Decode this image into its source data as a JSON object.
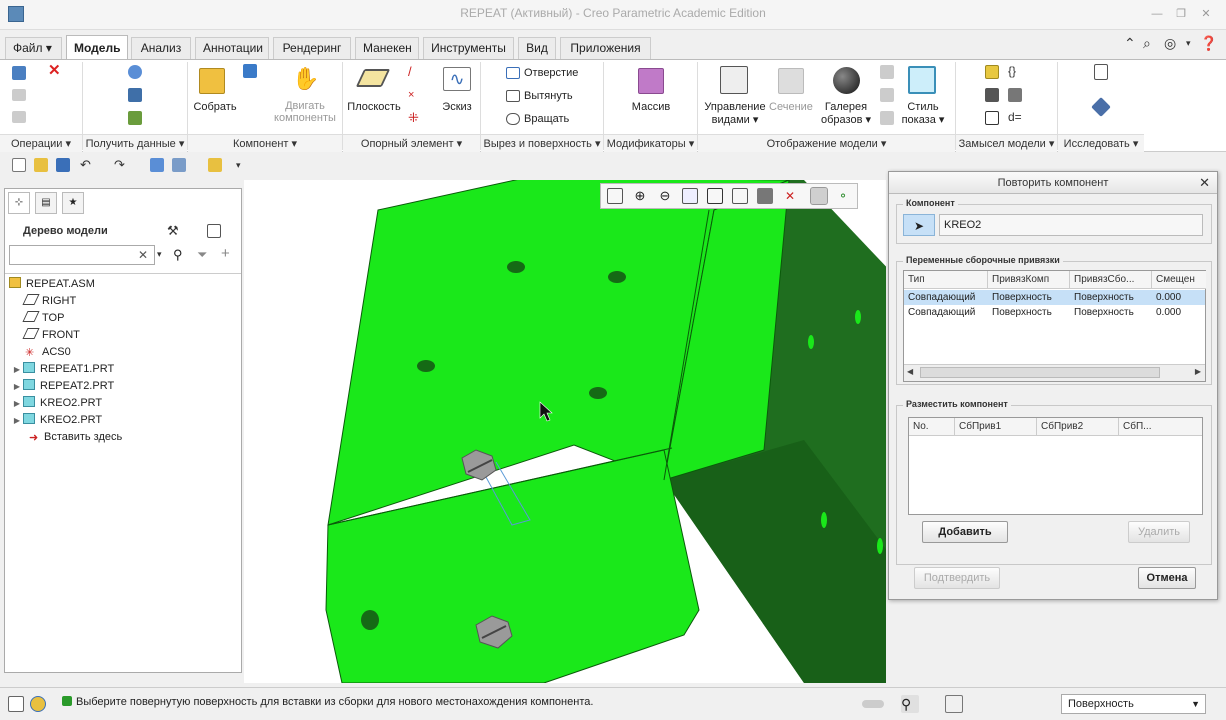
{
  "window": {
    "title": "REPEAT (Активный) - Creo Parametric Academic Edition"
  },
  "menu": {
    "file": "Файл",
    "tabs": [
      "Модель",
      "Анализ",
      "Аннотации",
      "Рендеринг",
      "Манекен",
      "Инструменты",
      "Вид",
      "Приложения"
    ]
  },
  "ribbon": {
    "assemble": "Собрать",
    "drag_components": [
      "Двигать",
      "компоненты"
    ],
    "plane": "Плоскость",
    "sketch": "Эскиз",
    "hole": "Отверстие",
    "extrude": "Вытянуть",
    "revolve": "Вращать",
    "pattern": "Массив",
    "manage_views": [
      "Управление",
      "видами"
    ],
    "section": "Сечение",
    "appearance_gallery": [
      "Галерея",
      "образов"
    ],
    "display_style": [
      "Стиль",
      "показа"
    ],
    "groups": [
      "Операции",
      "Получить данные",
      "Компонент",
      "Опорный элемент",
      "Вырез и поверхность",
      "Модификаторы",
      "Отображение модели",
      "Замысел модели",
      "Исследовать"
    ]
  },
  "model_tree": {
    "title": "Дерево модели",
    "search_placeholder": "",
    "items": [
      {
        "label": "REPEAT.ASM",
        "icon": "assembly-icon"
      },
      {
        "label": "RIGHT",
        "icon": "datum-plane-icon"
      },
      {
        "label": "TOP",
        "icon": "datum-plane-icon"
      },
      {
        "label": "FRONT",
        "icon": "datum-plane-icon"
      },
      {
        "label": "ACS0",
        "icon": "csys-icon"
      },
      {
        "label": "REPEAT1.PRT",
        "icon": "part-icon"
      },
      {
        "label": "REPEAT2.PRT",
        "icon": "part-icon"
      },
      {
        "label": "KREO2.PRT",
        "icon": "part-icon"
      },
      {
        "label": "KREO2.PRT",
        "icon": "part-icon"
      },
      {
        "label": "Вставить здесь",
        "icon": "insert-arrow-icon"
      }
    ]
  },
  "dialog": {
    "title": "Повторить компонент",
    "component_legend": "Компонент",
    "component_value": "KREO2",
    "refs_legend": "Переменные сборочные привязки",
    "refs_columns": [
      "Тип",
      "ПривязКомп",
      "ПривязСбо...",
      "Смещен"
    ],
    "refs_rows": [
      [
        "Совпадающий",
        "Поверхность",
        "Поверхность",
        "0.000"
      ],
      [
        "Совпадающий",
        "Поверхность",
        "Поверхность",
        "0.000"
      ]
    ],
    "place_legend": "Разместить компонент",
    "place_columns": [
      "No.",
      "СбПрив1",
      "СбПрив2",
      "СбП..."
    ],
    "add": "Добавить",
    "remove": "Удалить",
    "confirm": "Подтвердить",
    "cancel": "Отмена"
  },
  "status": {
    "message": "Выберите повернутую поверхность для вставки из сборки для нового местонахождения компонента.",
    "filter": "Поверхность"
  },
  "colors": {
    "model_green": "#1aef1a",
    "model_dark_green": "#1f6e1f",
    "selection_blue": "#c6e0f7"
  }
}
